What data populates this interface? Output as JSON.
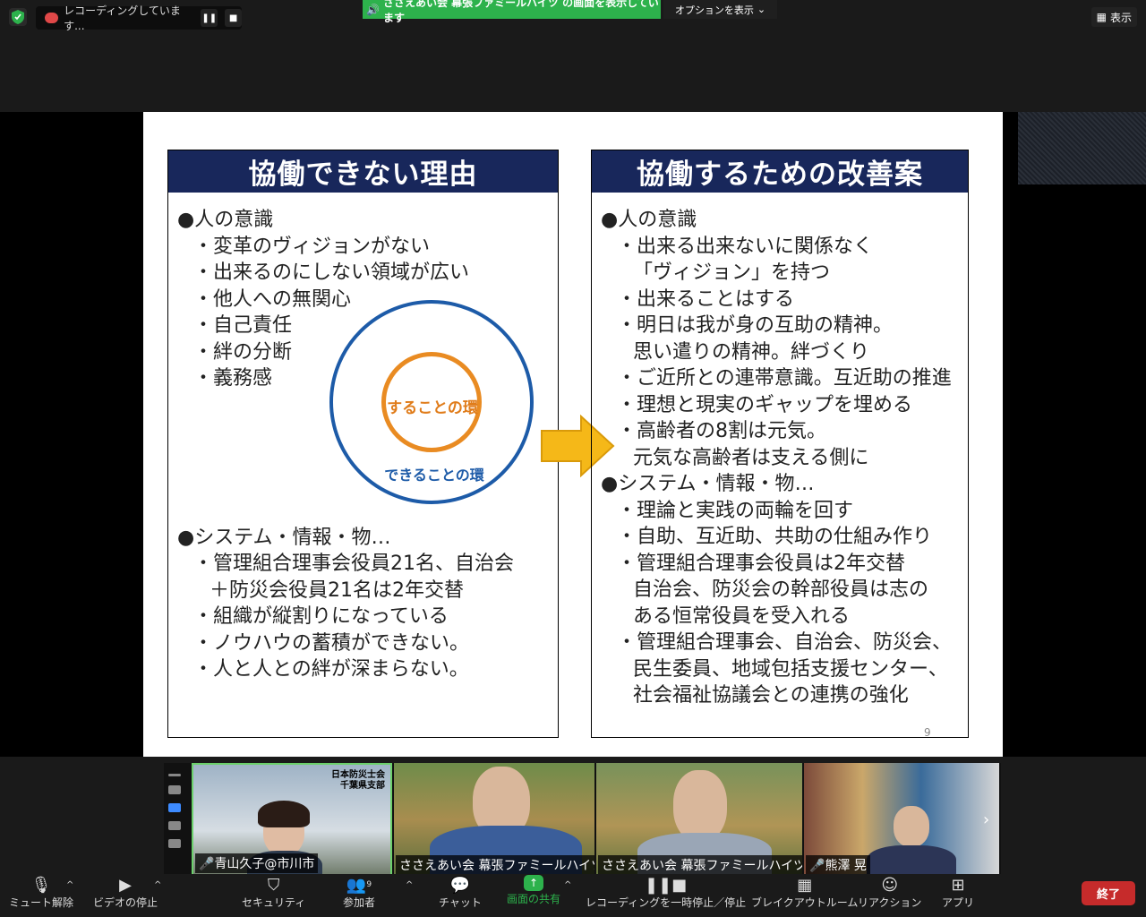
{
  "top": {
    "recording_label": "レコーディングしています...",
    "share_banner": "ささえあい会 幕張ファミールハイツ の画面を表示しています",
    "options_label": "オプションを表示",
    "view_label": "表示"
  },
  "slide": {
    "left_title": "協働できない理由",
    "right_title": "協働するための改善案",
    "left_lines": [
      {
        "text": "●人の意識",
        "indent": 0
      },
      {
        "text": "・変革のヴィジョンがない",
        "indent": 1
      },
      {
        "text": "・出来るのにしない領域が広い",
        "indent": 1
      },
      {
        "text": "・他人への無関心",
        "indent": 1
      },
      {
        "text": "・自己責任",
        "indent": 1
      },
      {
        "text": "・絆の分断",
        "indent": 1
      },
      {
        "text": "・義務感",
        "indent": 1
      }
    ],
    "left_lines2": [
      {
        "text": "●システム・情報・物…",
        "indent": 0
      },
      {
        "text": "・管理組合理事会役員21名、自治会",
        "indent": 1
      },
      {
        "text": "＋防災会役員21名は2年交替",
        "indent": 2
      },
      {
        "text": "・組織が縦割りになっている",
        "indent": 1
      },
      {
        "text": "・ノウハウの蓄積ができない。",
        "indent": 1
      },
      {
        "text": "・人と人との絆が深まらない。",
        "indent": 1
      }
    ],
    "inner_circle_label": "することの環",
    "outer_circle_label": "できることの環",
    "right_lines": [
      {
        "text": "●人の意識",
        "indent": 0
      },
      {
        "text": "・出来る出来ないに関係なく",
        "indent": 1
      },
      {
        "text": "「ヴィジョン」を持つ",
        "indent": 2
      },
      {
        "text": "・出来ることはする",
        "indent": 1
      },
      {
        "text": "・明日は我が身の互助の精神。",
        "indent": 1
      },
      {
        "text": "思い遣りの精神。絆づくり",
        "indent": 2
      },
      {
        "text": "・ご近所との連帯意識。互近助の推進",
        "indent": 1
      },
      {
        "text": "・理想と現実のギャップを埋める",
        "indent": 1
      },
      {
        "text": "・高齢者の8割は元気。",
        "indent": 1
      },
      {
        "text": "元気な高齢者は支える側に",
        "indent": 2
      },
      {
        "text": "●システム・情報・物…",
        "indent": 0
      },
      {
        "text": "・理論と実践の両輪を回す",
        "indent": 1
      },
      {
        "text": "・自助、互近助、共助の仕組み作り",
        "indent": 1
      },
      {
        "text": "・管理組合理事会役員は2年交替",
        "indent": 1
      },
      {
        "text": "自治会、防災会の幹部役員は志の",
        "indent": 2
      },
      {
        "text": "ある恒常役員を受入れる",
        "indent": 2
      },
      {
        "text": "・管理組合理事会、自治会、防災会、",
        "indent": 1
      },
      {
        "text": "民生委員、地域包括支援センター、",
        "indent": 2
      },
      {
        "text": "社会福祉協議会との連携の強化",
        "indent": 2
      }
    ],
    "page_number": "9"
  },
  "participants": [
    {
      "name": "青山久子@市川市",
      "org_line1": "日本防災士会",
      "org_line2": "千葉県支部",
      "muted": true
    },
    {
      "name": "ささえあい会 幕張ファミールハイツ"
    },
    {
      "name": "ささえあい会 幕張ファミールハイツ"
    },
    {
      "name": "熊澤 晃",
      "muted": true
    }
  ],
  "toolbar": {
    "mute": "ミュート解除",
    "video": "ビデオの停止",
    "security": "セキュリティ",
    "participants": "参加者",
    "participants_count": "9",
    "chat": "チャット",
    "share": "画面の共有",
    "record": "レコーディングを一時停止／停止",
    "breakout": "ブレイクアウトルーム",
    "reactions": "リアクション",
    "apps": "アプリ",
    "end": "終了"
  },
  "colors": {
    "share_green": "#2db24c",
    "title_navy": "#18275b",
    "end_red": "#c62b2b",
    "circle_blue": "#1d5ba8",
    "circle_orange": "#e98b22",
    "arrow_yellow": "#f5b818"
  }
}
